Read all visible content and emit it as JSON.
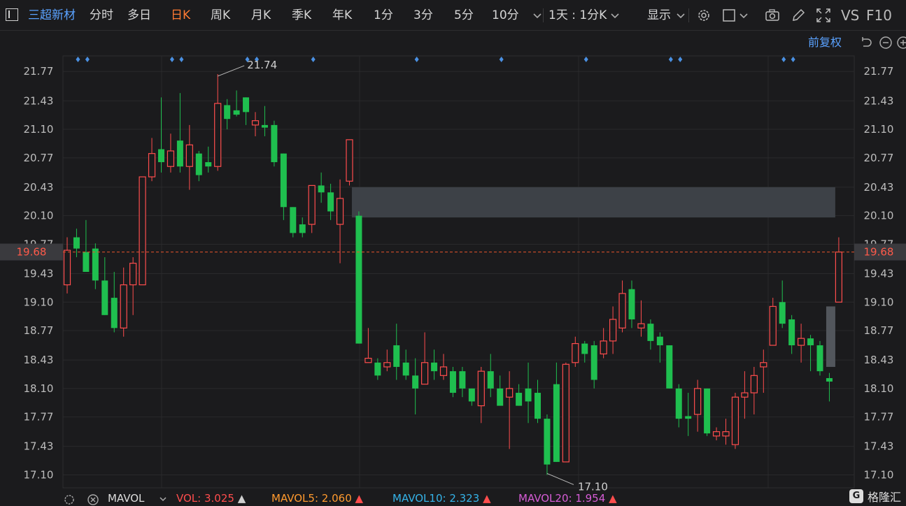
{
  "toolbar": {
    "stock_name": "三超新材",
    "periods": [
      "分时",
      "多日",
      "日K",
      "周K",
      "月K",
      "季K",
      "年K",
      "1分",
      "3分",
      "5分",
      "10分"
    ],
    "active_period": "日K",
    "timeframe_label": "1天 : 1分K",
    "display_label": "显示",
    "vs_label": "VS",
    "f10_label": "F10",
    "adjust_label": "前复权"
  },
  "colors": {
    "up": "#ff4d4d",
    "down": "#1fbf4f",
    "marker": "#4a90e2",
    "price_line": "#e8542c",
    "gap_box": "#3d4147"
  },
  "chart_data": {
    "type": "candlestick",
    "ylim": [
      16.95,
      21.95
    ],
    "y_ticks": [
      21.77,
      21.43,
      21.1,
      20.77,
      20.43,
      20.1,
      19.77,
      19.43,
      19.1,
      18.77,
      18.43,
      18.1,
      17.77,
      17.43,
      17.1
    ],
    "current_price": "19.68",
    "high_label": "21.74",
    "low_label": "17.10",
    "candles": [
      {
        "o": 19.3,
        "h": 19.85,
        "l": 19.2,
        "c": 19.7
      },
      {
        "o": 19.85,
        "h": 19.95,
        "l": 19.62,
        "c": 19.72
      },
      {
        "o": 19.68,
        "h": 20.05,
        "l": 19.45,
        "c": 19.45
      },
      {
        "o": 19.72,
        "h": 19.78,
        "l": 19.25,
        "c": 19.35
      },
      {
        "o": 19.35,
        "h": 19.62,
        "l": 18.95,
        "c": 18.95
      },
      {
        "o": 19.15,
        "h": 19.45,
        "l": 18.75,
        "c": 18.8
      },
      {
        "o": 18.8,
        "h": 19.5,
        "l": 18.7,
        "c": 19.3
      },
      {
        "o": 19.3,
        "h": 19.62,
        "l": 18.95,
        "c": 19.55
      },
      {
        "o": 19.3,
        "h": 20.55,
        "l": 19.3,
        "c": 20.55
      },
      {
        "o": 20.55,
        "h": 21.0,
        "l": 20.5,
        "c": 20.82
      },
      {
        "o": 20.87,
        "h": 21.47,
        "l": 20.6,
        "c": 20.72
      },
      {
        "o": 20.67,
        "h": 21.05,
        "l": 20.6,
        "c": 20.85
      },
      {
        "o": 20.97,
        "h": 21.52,
        "l": 20.6,
        "c": 20.67
      },
      {
        "o": 20.67,
        "h": 21.15,
        "l": 20.4,
        "c": 20.92
      },
      {
        "o": 20.82,
        "h": 20.85,
        "l": 20.5,
        "c": 20.57
      },
      {
        "o": 20.72,
        "h": 20.9,
        "l": 20.6,
        "c": 20.67
      },
      {
        "o": 20.67,
        "h": 21.74,
        "l": 20.62,
        "c": 21.4
      },
      {
        "o": 21.38,
        "h": 21.45,
        "l": 21.1,
        "c": 21.22
      },
      {
        "o": 21.32,
        "h": 21.55,
        "l": 21.25,
        "c": 21.27
      },
      {
        "o": 21.47,
        "h": 21.47,
        "l": 21.15,
        "c": 21.3
      },
      {
        "o": 21.15,
        "h": 21.3,
        "l": 21.02,
        "c": 21.2
      },
      {
        "o": 21.15,
        "h": 21.37,
        "l": 21.02,
        "c": 21.12
      },
      {
        "o": 21.15,
        "h": 21.2,
        "l": 20.67,
        "c": 20.72
      },
      {
        "o": 20.82,
        "h": 20.82,
        "l": 20.05,
        "c": 20.2
      },
      {
        "o": 20.2,
        "h": 20.2,
        "l": 19.85,
        "c": 19.9
      },
      {
        "o": 20.0,
        "h": 20.08,
        "l": 19.85,
        "c": 19.9
      },
      {
        "o": 20.0,
        "h": 20.32,
        "l": 19.9,
        "c": 20.45
      },
      {
        "o": 20.45,
        "h": 20.6,
        "l": 20.25,
        "c": 20.37
      },
      {
        "o": 20.37,
        "h": 20.47,
        "l": 20.05,
        "c": 20.15
      },
      {
        "o": 20.0,
        "h": 20.52,
        "l": 19.55,
        "c": 20.3
      },
      {
        "o": 20.5,
        "h": 20.98,
        "l": 20.45,
        "c": 20.98
      },
      {
        "o": 20.1,
        "h": 20.15,
        "l": 18.62,
        "c": 18.62
      },
      {
        "o": 18.4,
        "h": 18.8,
        "l": 18.4,
        "c": 18.45
      },
      {
        "o": 18.4,
        "h": 18.45,
        "l": 18.2,
        "c": 18.25
      },
      {
        "o": 18.35,
        "h": 18.55,
        "l": 18.3,
        "c": 18.4
      },
      {
        "o": 18.6,
        "h": 18.85,
        "l": 18.2,
        "c": 18.35
      },
      {
        "o": 18.4,
        "h": 18.55,
        "l": 18.2,
        "c": 18.25
      },
      {
        "o": 18.25,
        "h": 18.45,
        "l": 17.8,
        "c": 18.1
      },
      {
        "o": 18.15,
        "h": 18.75,
        "l": 18.15,
        "c": 18.4
      },
      {
        "o": 18.4,
        "h": 18.55,
        "l": 18.2,
        "c": 18.3
      },
      {
        "o": 18.25,
        "h": 18.5,
        "l": 18.2,
        "c": 18.35
      },
      {
        "o": 18.3,
        "h": 18.35,
        "l": 18.0,
        "c": 18.05
      },
      {
        "o": 18.3,
        "h": 18.35,
        "l": 18.0,
        "c": 18.1
      },
      {
        "o": 18.1,
        "h": 18.1,
        "l": 17.9,
        "c": 17.95
      },
      {
        "o": 17.9,
        "h": 18.35,
        "l": 17.7,
        "c": 18.3
      },
      {
        "o": 18.3,
        "h": 18.5,
        "l": 18.0,
        "c": 18.1
      },
      {
        "o": 18.1,
        "h": 18.25,
        "l": 17.98,
        "c": 17.9
      },
      {
        "o": 18.0,
        "h": 18.3,
        "l": 17.4,
        "c": 18.1
      },
      {
        "o": 18.05,
        "h": 18.15,
        "l": 17.9,
        "c": 17.9
      },
      {
        "o": 18.1,
        "h": 18.4,
        "l": 17.7,
        "c": 17.95
      },
      {
        "o": 18.05,
        "h": 18.2,
        "l": 17.7,
        "c": 17.75
      },
      {
        "o": 17.75,
        "h": 17.8,
        "l": 17.1,
        "c": 17.22
      },
      {
        "o": 18.15,
        "h": 18.4,
        "l": 17.25,
        "c": 17.25
      },
      {
        "o": 17.25,
        "h": 18.4,
        "l": 17.25,
        "c": 18.38
      },
      {
        "o": 18.4,
        "h": 18.7,
        "l": 18.35,
        "c": 18.62
      },
      {
        "o": 18.62,
        "h": 18.65,
        "l": 18.4,
        "c": 18.5
      },
      {
        "o": 18.6,
        "h": 18.65,
        "l": 18.1,
        "c": 18.2
      },
      {
        "o": 18.5,
        "h": 18.8,
        "l": 18.45,
        "c": 18.65
      },
      {
        "o": 18.65,
        "h": 19.05,
        "l": 18.5,
        "c": 18.9
      },
      {
        "o": 18.8,
        "h": 19.35,
        "l": 18.75,
        "c": 19.2
      },
      {
        "o": 19.25,
        "h": 19.35,
        "l": 18.8,
        "c": 18.9
      },
      {
        "o": 18.8,
        "h": 19.12,
        "l": 18.7,
        "c": 18.85
      },
      {
        "o": 18.85,
        "h": 18.9,
        "l": 18.55,
        "c": 18.65
      },
      {
        "o": 18.7,
        "h": 18.75,
        "l": 18.4,
        "c": 18.6
      },
      {
        "o": 18.6,
        "h": 18.6,
        "l": 18.1,
        "c": 18.1
      },
      {
        "o": 18.1,
        "h": 18.15,
        "l": 17.65,
        "c": 17.75
      },
      {
        "o": 17.78,
        "h": 18.05,
        "l": 17.55,
        "c": 17.75
      },
      {
        "o": 17.8,
        "h": 18.2,
        "l": 17.6,
        "c": 18.1
      },
      {
        "o": 18.1,
        "h": 18.1,
        "l": 17.55,
        "c": 17.58
      },
      {
        "o": 17.55,
        "h": 17.65,
        "l": 17.5,
        "c": 17.6
      },
      {
        "o": 17.55,
        "h": 17.75,
        "l": 17.45,
        "c": 17.6
      },
      {
        "o": 17.45,
        "h": 18.05,
        "l": 17.4,
        "c": 18.0
      },
      {
        "o": 18.0,
        "h": 18.3,
        "l": 17.75,
        "c": 18.05
      },
      {
        "o": 18.05,
        "h": 18.35,
        "l": 17.8,
        "c": 18.25
      },
      {
        "o": 18.35,
        "h": 18.55,
        "l": 18.05,
        "c": 18.4
      },
      {
        "o": 18.6,
        "h": 19.15,
        "l": 18.6,
        "c": 19.05
      },
      {
        "o": 19.1,
        "h": 19.35,
        "l": 18.8,
        "c": 18.85
      },
      {
        "o": 18.9,
        "h": 18.95,
        "l": 18.5,
        "c": 18.6
      },
      {
        "o": 18.6,
        "h": 18.85,
        "l": 18.4,
        "c": 18.68
      },
      {
        "o": 18.68,
        "h": 18.72,
        "l": 18.3,
        "c": 18.6
      },
      {
        "o": 18.6,
        "h": 18.65,
        "l": 18.25,
        "c": 18.3
      },
      {
        "o": 18.22,
        "h": 18.28,
        "l": 17.95,
        "c": 18.18
      },
      {
        "o": 19.1,
        "h": 19.85,
        "l": 19.1,
        "c": 19.68
      }
    ],
    "markers_after_candle": [
      1,
      2,
      11,
      12,
      19,
      20,
      26,
      37,
      46,
      55,
      64,
      65,
      76,
      77
    ],
    "gap_zone": {
      "from_candle": 31,
      "to_candle": 82,
      "low": 20.08,
      "high": 20.43
    },
    "pending_bar": {
      "candle": 81,
      "low": 18.35,
      "high": 19.05
    },
    "volume_legend": {
      "indicator": "MAVOL",
      "items": [
        {
          "label": "VOL:",
          "value": "3.025",
          "color": "#ff4d4d"
        },
        {
          "label": "MAVOL5:",
          "value": "2.060",
          "color": "#ff9a2e"
        },
        {
          "label": "MAVOL10:",
          "value": "2.323",
          "color": "#35b3e8"
        },
        {
          "label": "MAVOL20:",
          "value": "1.954",
          "color": "#d65cd6"
        }
      ]
    }
  },
  "watermark": "格隆汇"
}
